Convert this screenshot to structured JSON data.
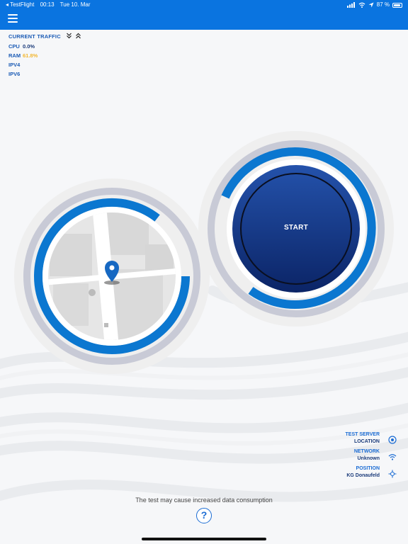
{
  "status_bar": {
    "back_app": "◂ TestFlight",
    "time": "00:13",
    "date": "Tue 10. Mar",
    "battery": "87 %",
    "battery_level": 0.87
  },
  "traffic": {
    "title": "CURRENT TRAFFIC",
    "rows": [
      {
        "key": "CPU",
        "value": "0.0%"
      },
      {
        "key": "RAM",
        "value": "61.8%"
      },
      {
        "key": "IPV4",
        "value": ""
      },
      {
        "key": "IPV6",
        "value": ""
      }
    ]
  },
  "start": {
    "label": "START"
  },
  "info": {
    "test_server_label": "TEST SERVER",
    "test_server_value": "LOCATION",
    "network_label": "NETWORK",
    "network_value": "Unknown",
    "position_label": "POSITION",
    "position_value": "KG Donaufeld"
  },
  "notice": "The test may cause increased data consumption",
  "help_label": "?",
  "colors": {
    "header": "#0a74e0",
    "ring_blue": "#0b77d0",
    "ring_gray": "#c8cad6",
    "start_top": "#1f4ea8",
    "start_bottom": "#0b2466",
    "ram_value": "#f2b731"
  },
  "icons": {
    "menu": "hamburger-icon",
    "expand": "chevron-double-down-icon",
    "collapse": "chevron-double-up-icon",
    "server": "target-icon",
    "network": "wifi-icon",
    "position": "crosshair-icon",
    "map_pin": "map-pin-icon"
  }
}
